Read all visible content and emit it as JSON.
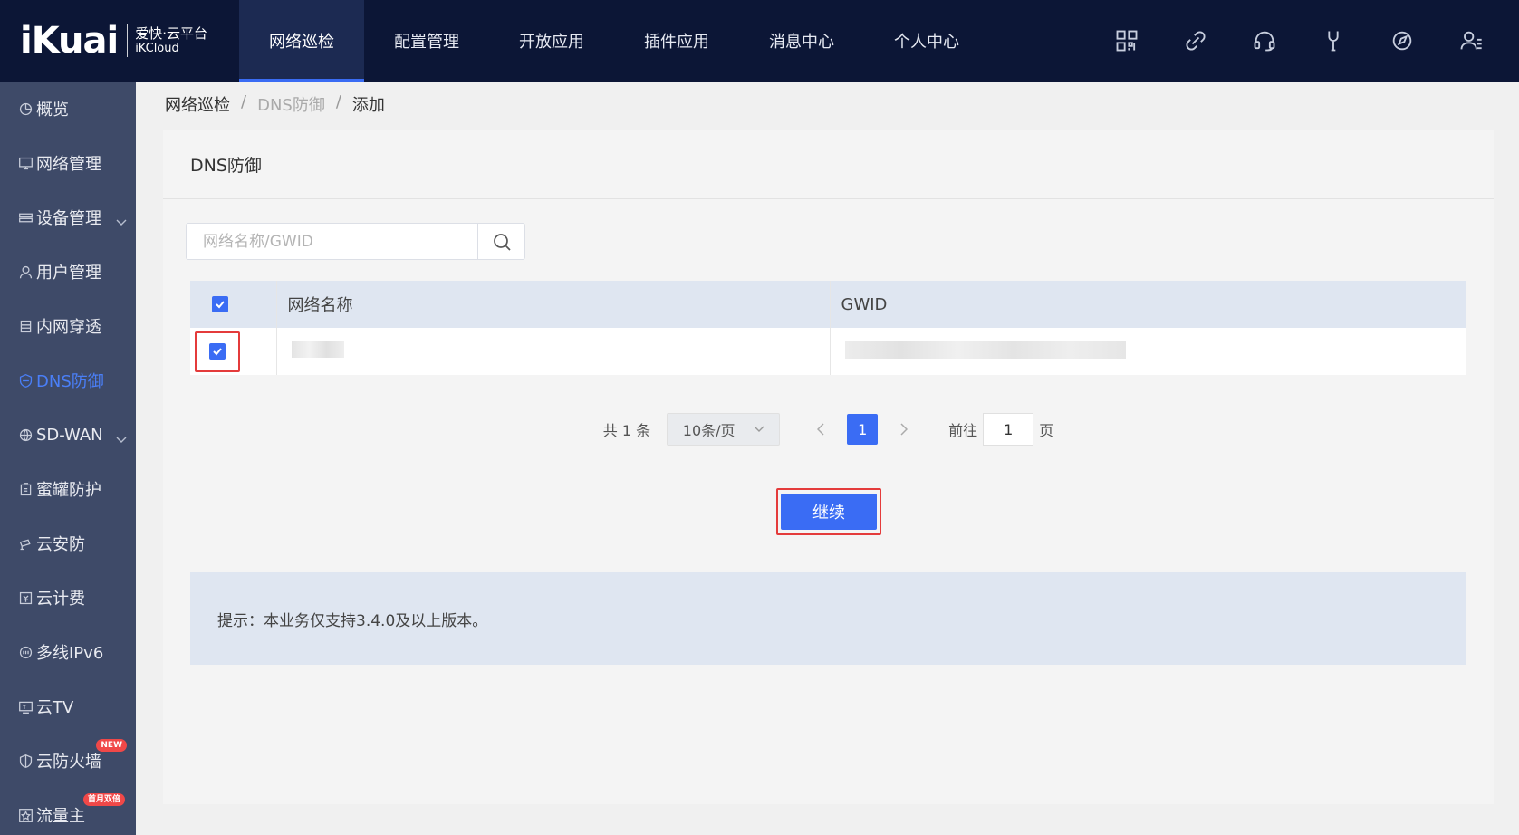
{
  "logo": {
    "main": "iKuai",
    "sub1": "爱快·云平台",
    "sub2": "iKCloud"
  },
  "topnav": [
    {
      "label": "网络巡检",
      "active": true
    },
    {
      "label": "配置管理"
    },
    {
      "label": "开放应用"
    },
    {
      "label": "插件应用"
    },
    {
      "label": "消息中心"
    },
    {
      "label": "个人中心"
    }
  ],
  "top_icons": [
    "qr-code-icon",
    "link-icon",
    "headset-icon",
    "wrench-icon",
    "compass-icon",
    "user-menu-icon"
  ],
  "sidebar": {
    "items": [
      {
        "label": "概览",
        "icon": "dashboard-icon"
      },
      {
        "label": "网络管理",
        "icon": "monitor-icon"
      },
      {
        "label": "设备管理",
        "icon": "device-icon",
        "expandable": true
      },
      {
        "label": "用户管理",
        "icon": "user-icon"
      },
      {
        "label": "内网穿透",
        "icon": "tunnel-icon"
      },
      {
        "label": "DNS防御",
        "icon": "shield-icon",
        "active": true
      },
      {
        "label": "SD-WAN",
        "icon": "globe-icon",
        "expandable": true
      },
      {
        "label": "蜜罐防护",
        "icon": "honeypot-icon"
      },
      {
        "label": "云安防",
        "icon": "camera-icon"
      },
      {
        "label": "云计费",
        "icon": "billing-icon"
      },
      {
        "label": "多线IPv6",
        "icon": "ipv6-icon"
      },
      {
        "label": "云TV",
        "icon": "tv-icon"
      },
      {
        "label": "云防火墙",
        "icon": "firewall-icon",
        "badge": "NEW"
      },
      {
        "label": "流量主",
        "icon": "star-icon",
        "badge": "首月双倍"
      }
    ]
  },
  "breadcrumb": [
    "网络巡检",
    "DNS防御",
    "添加"
  ],
  "panel": {
    "title": "DNS防御"
  },
  "search": {
    "placeholder": "网络名称/GWID",
    "value": ""
  },
  "table": {
    "headers": [
      "网络名称",
      "GWID"
    ],
    "rows": [
      {
        "checked": true
      }
    ]
  },
  "pagination": {
    "total_text": "共 1 条",
    "page_size": "10条/页",
    "current_page": "1",
    "goto_label": "前往",
    "goto_value": "1",
    "goto_unit": "页"
  },
  "continue_label": "继续",
  "tip": "提示：本业务仅支持3.4.0及以上版本。",
  "colors": {
    "topbar": "#0c1636",
    "sidebar": "#3e4a68",
    "accent": "#3a6cf4",
    "highlight": "#e43b3b"
  }
}
